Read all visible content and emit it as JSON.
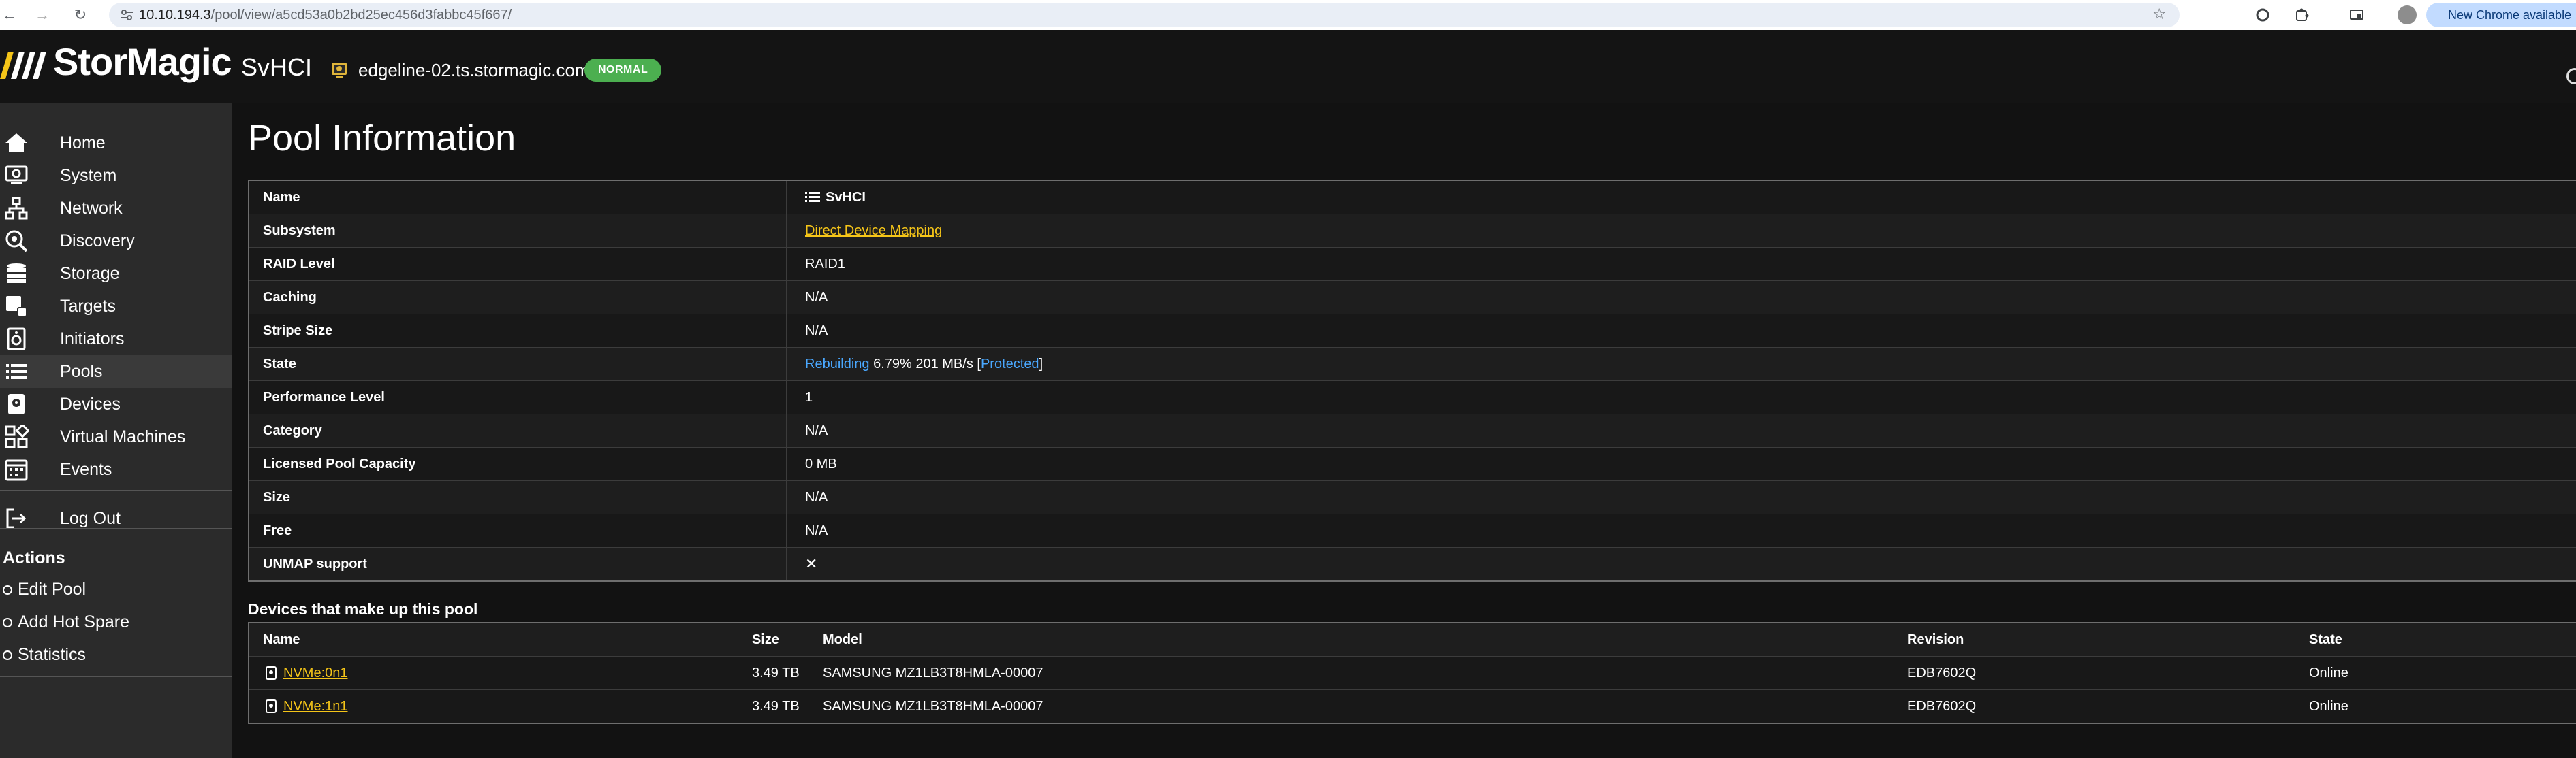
{
  "browser": {
    "url_host": "10.10.194.3",
    "url_path": "/pool/view/a5cd53a0b2bd25ec456d3fabbc45f667/",
    "update_label": "New Chrome available"
  },
  "header": {
    "brand": "StorMagic",
    "product": "SvHCI",
    "host": "edgeline-02.ts.stormagic.com",
    "status_badge": "NORMAL"
  },
  "sidebar": {
    "items": [
      {
        "label": "Home",
        "icon": "home-icon"
      },
      {
        "label": "System",
        "icon": "system-icon"
      },
      {
        "label": "Network",
        "icon": "network-icon"
      },
      {
        "label": "Discovery",
        "icon": "discovery-icon"
      },
      {
        "label": "Storage",
        "icon": "storage-icon"
      },
      {
        "label": "Targets",
        "icon": "targets-icon"
      },
      {
        "label": "Initiators",
        "icon": "initiators-icon"
      },
      {
        "label": "Pools",
        "icon": "pools-icon"
      },
      {
        "label": "Devices",
        "icon": "devices-icon"
      },
      {
        "label": "Virtual Machines",
        "icon": "vm-icon"
      },
      {
        "label": "Events",
        "icon": "events-icon"
      }
    ],
    "logout": "Log Out",
    "actions_title": "Actions",
    "actions": [
      "Edit Pool",
      "Add Hot Spare",
      "Statistics"
    ]
  },
  "page": {
    "title": "Pool Information"
  },
  "pool_info": [
    {
      "key": "Name",
      "value": "SvHCI"
    },
    {
      "key": "Subsystem",
      "value": "Direct Device Mapping"
    },
    {
      "key": "RAID Level",
      "value": "RAID1"
    },
    {
      "key": "Caching",
      "value": "N/A"
    },
    {
      "key": "Stripe Size",
      "value": "N/A"
    },
    {
      "key": "State",
      "value": ""
    },
    {
      "key": "Performance Level",
      "value": "1"
    },
    {
      "key": "Category",
      "value": "N/A"
    },
    {
      "key": "Licensed Pool Capacity",
      "value": "0 MB"
    },
    {
      "key": "Size",
      "value": "N/A"
    },
    {
      "key": "Free",
      "value": "N/A"
    },
    {
      "key": "UNMAP support",
      "value": "✕"
    }
  ],
  "state": {
    "status": "Rebuilding",
    "detail": "6.79% 201 MB/s [",
    "protection": "Protected",
    "close": "]"
  },
  "devices": {
    "title": "Devices that make up this pool",
    "headers": [
      "Name",
      "Size",
      "Model",
      "Revision",
      "State"
    ],
    "rows": [
      {
        "name": "NVMe:0n1",
        "size": "3.49 TB",
        "model": "SAMSUNG MZ1LB3T8HMLA-00007",
        "revision": "EDB7602Q",
        "state": "Online"
      },
      {
        "name": "NVMe:1n1",
        "size": "3.49 TB",
        "model": "SAMSUNG MZ1LB3T8HMLA-00007",
        "revision": "EDB7602Q",
        "state": "Online"
      }
    ]
  },
  "colors": {
    "accent_yellow": "#f5c518",
    "link_blue": "#4aa8ff",
    "online_green": "#5cd65c",
    "badge_green": "#4caf50"
  }
}
